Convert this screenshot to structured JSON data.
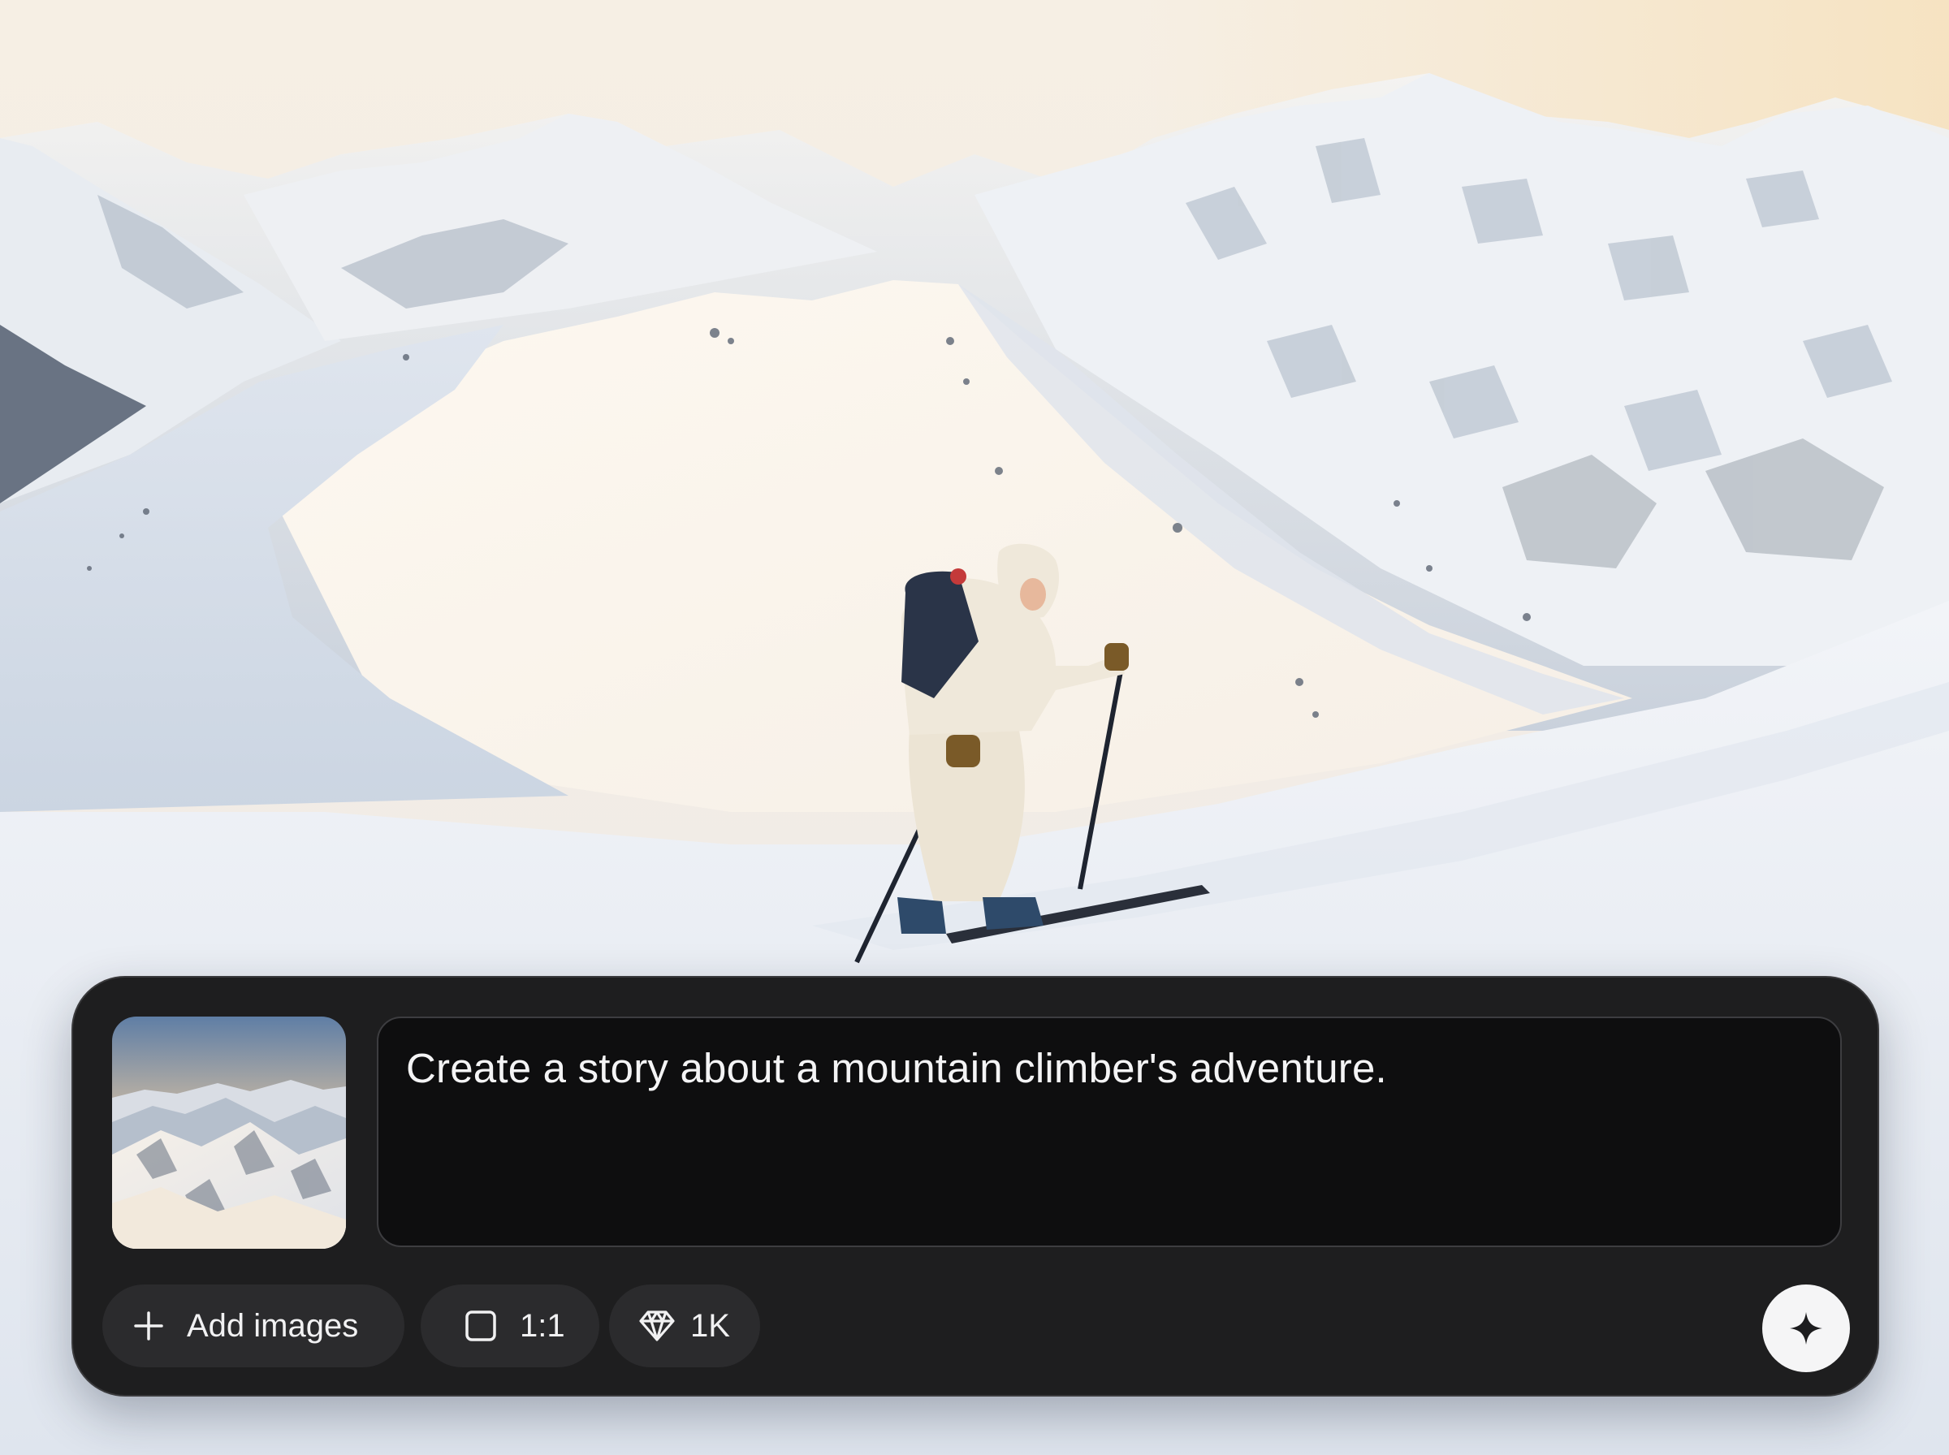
{
  "background": {
    "image": "alpine-ski-tour-photo"
  },
  "composer": {
    "reference_image": "mountain-range-thumbnail",
    "prompt_text": "Create a story about a mountain climber's adventure.",
    "add_images_label": "Add images",
    "aspect_ratio_label": "1:1",
    "resolution_label": "1K",
    "icons": {
      "add": "plus-icon",
      "aspect_ratio": "square-icon",
      "resolution": "diamond-icon",
      "send": "sparkle-icon"
    }
  },
  "colors": {
    "panel": "#1e1e1f",
    "prompt_box": "#0e0e0f",
    "chip": "#2b2b2d",
    "send_button": "#f5f5f6",
    "text": "#f4f4f5"
  }
}
